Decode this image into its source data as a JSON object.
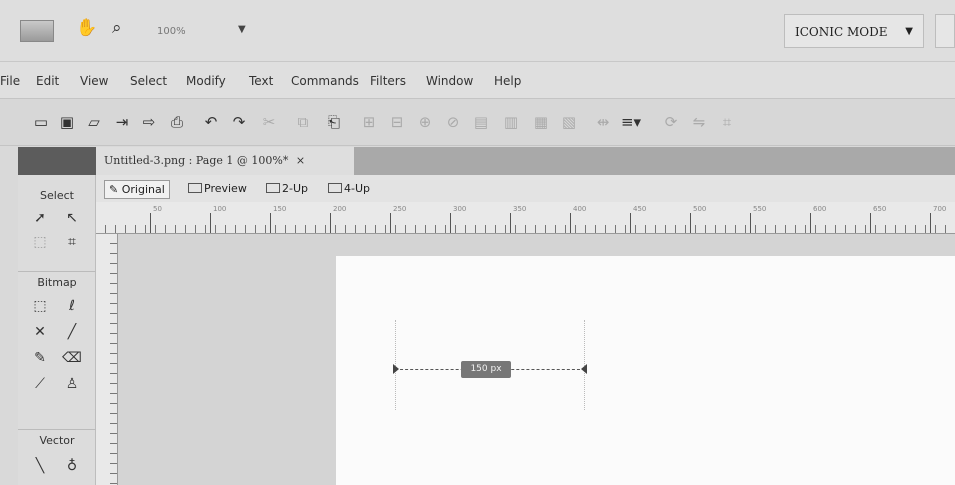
{
  "topbar": {
    "zoom_value": "100%",
    "mode_label": "ICONIC MODE",
    "icons": [
      "app-logo-icon",
      "hand-icon",
      "magnifier-icon",
      "dropdown-arrow-icon"
    ]
  },
  "menubar": {
    "items": [
      "File",
      "Edit",
      "View",
      "Select",
      "Modify",
      "Text",
      "Commands",
      "Filters",
      "Window",
      "Help"
    ]
  },
  "toolbar": {
    "icons": [
      "new-icon",
      "save-icon",
      "open-icon",
      "import-icon",
      "export-icon",
      "print-icon",
      "undo-icon",
      "redo-icon",
      "cut-icon",
      "copy-icon",
      "paste-icon",
      "group-icon",
      "ungroup-icon",
      "join-icon",
      "split-icon",
      "bring-front-icon",
      "send-back-icon",
      "align-left-icon",
      "align-right-icon",
      "distribute-icon",
      "align-menu-icon",
      "rotate-icon",
      "flip-icon",
      "snap-icon"
    ]
  },
  "tools": {
    "sections": [
      "Select",
      "Bitmap",
      "Vector"
    ]
  },
  "document": {
    "tab_title": "Untitled-3.png : Page 1 @ 100%*",
    "close_glyph": "×",
    "view_tabs": [
      "Original",
      "Preview",
      "2-Up",
      "4-Up"
    ]
  },
  "ruler": {
    "labels": [
      "50",
      "100",
      "150",
      "200",
      "250",
      "300",
      "350",
      "400",
      "450",
      "500",
      "550",
      "600",
      "650",
      "700",
      "750"
    ]
  },
  "canvas": {
    "measure_label": "150 px"
  }
}
